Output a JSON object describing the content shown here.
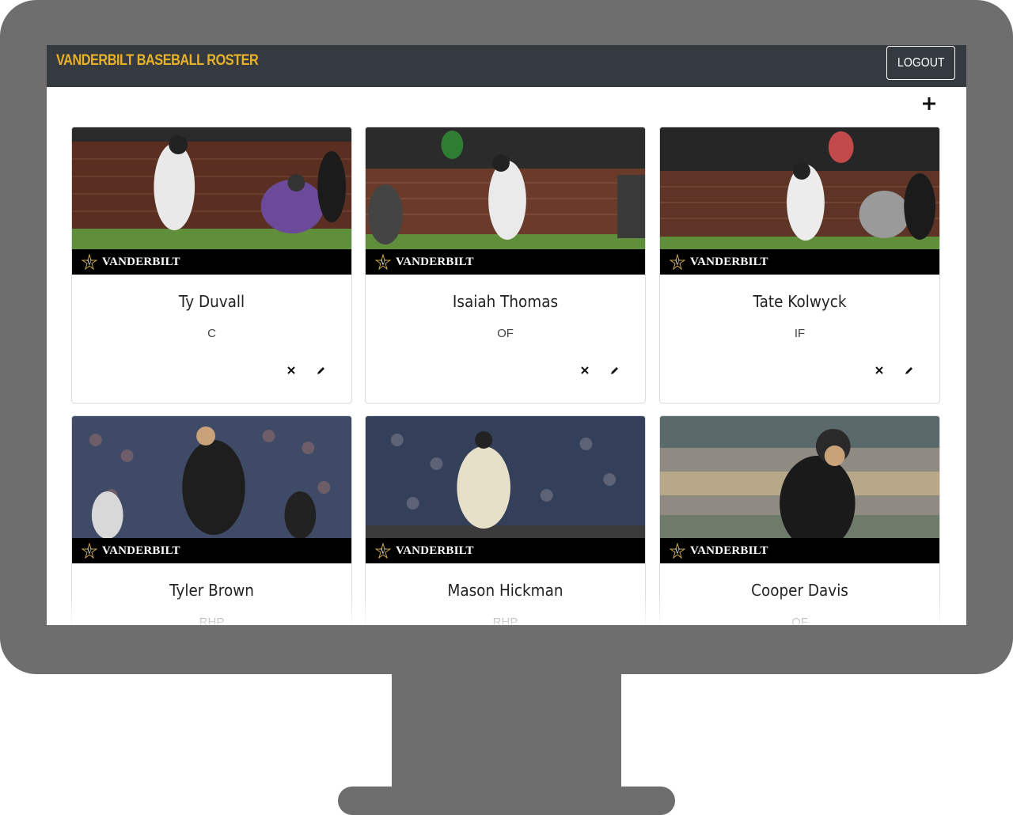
{
  "app": {
    "brand": "VANDERBILT BASEBALL ROSTER",
    "logout_label": "LOGOUT",
    "accent_color": "#e8b127",
    "navbar_color": "#343a40"
  },
  "card_banner": "VANDERBILT",
  "players": [
    {
      "name": "Ty Duvall",
      "position": "C"
    },
    {
      "name": "Isaiah Thomas",
      "position": "OF"
    },
    {
      "name": "Tate Kolwyck",
      "position": "IF"
    },
    {
      "name": "Tyler Brown",
      "position": "RHP"
    },
    {
      "name": "Mason Hickman",
      "position": "RHP"
    },
    {
      "name": "Cooper Davis",
      "position": "OF"
    }
  ],
  "icons": {
    "add": "plus-icon",
    "delete": "close-icon",
    "edit": "pencil-icon",
    "banner": "star-v-logo"
  }
}
